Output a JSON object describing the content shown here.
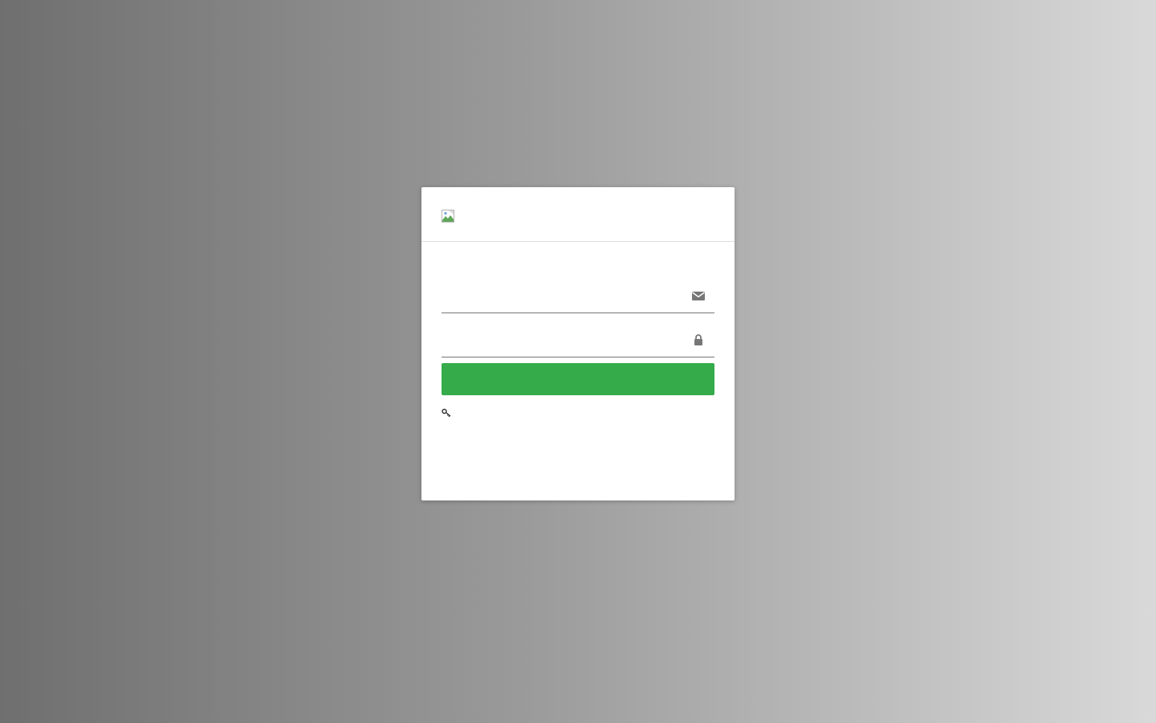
{
  "login": {
    "logo_alt": "",
    "email": {
      "value": "",
      "placeholder": "",
      "icon": "envelope-icon"
    },
    "password": {
      "value": "",
      "placeholder": "",
      "icon": "lock-icon"
    },
    "submit_label": "",
    "forgot_password": {
      "label": "",
      "icon": "key-icon"
    }
  },
  "colors": {
    "button": "#35ab4a",
    "card": "#ffffff",
    "input_icon": "#777777"
  }
}
